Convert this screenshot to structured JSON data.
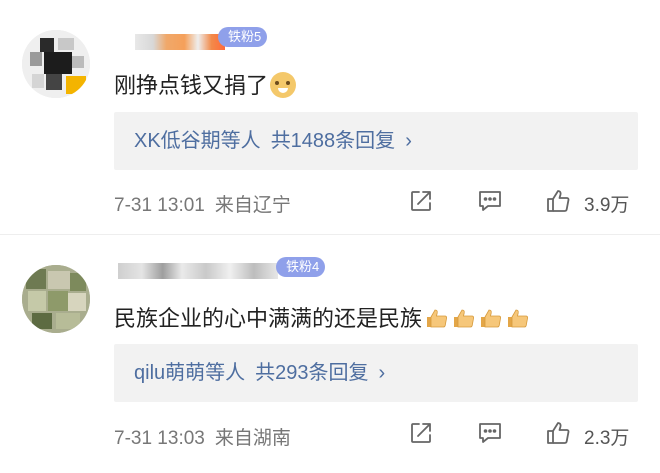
{
  "comments": [
    {
      "fan_badge": "铁粉5",
      "text": "刚挣点钱又捐了",
      "emoji": "doge-emoji",
      "replies": {
        "who": "XK低谷期等人",
        "count": "共1488条回复",
        "chevron": "›"
      },
      "date": "7-31 13:01",
      "location": "来自辽宁",
      "likes": "3.9万"
    },
    {
      "fan_badge": "铁粉4",
      "text": "民族企业的心中满满的还是民族",
      "emoji": "thumbs-up-emoji",
      "emoji_count": 4,
      "replies": {
        "who": "qilu萌萌等人",
        "count": "共293条回复",
        "chevron": "›"
      },
      "date": "7-31 13:03",
      "location": "来自湖南",
      "likes": "2.3万"
    }
  ],
  "icons": {
    "share": "share-icon",
    "reply": "comment-icon",
    "like": "thumbs-up-icon"
  },
  "colors": {
    "link": "#4e6ea0",
    "badge": "#8fa0ea",
    "reply_bg": "#f2f2f2"
  }
}
